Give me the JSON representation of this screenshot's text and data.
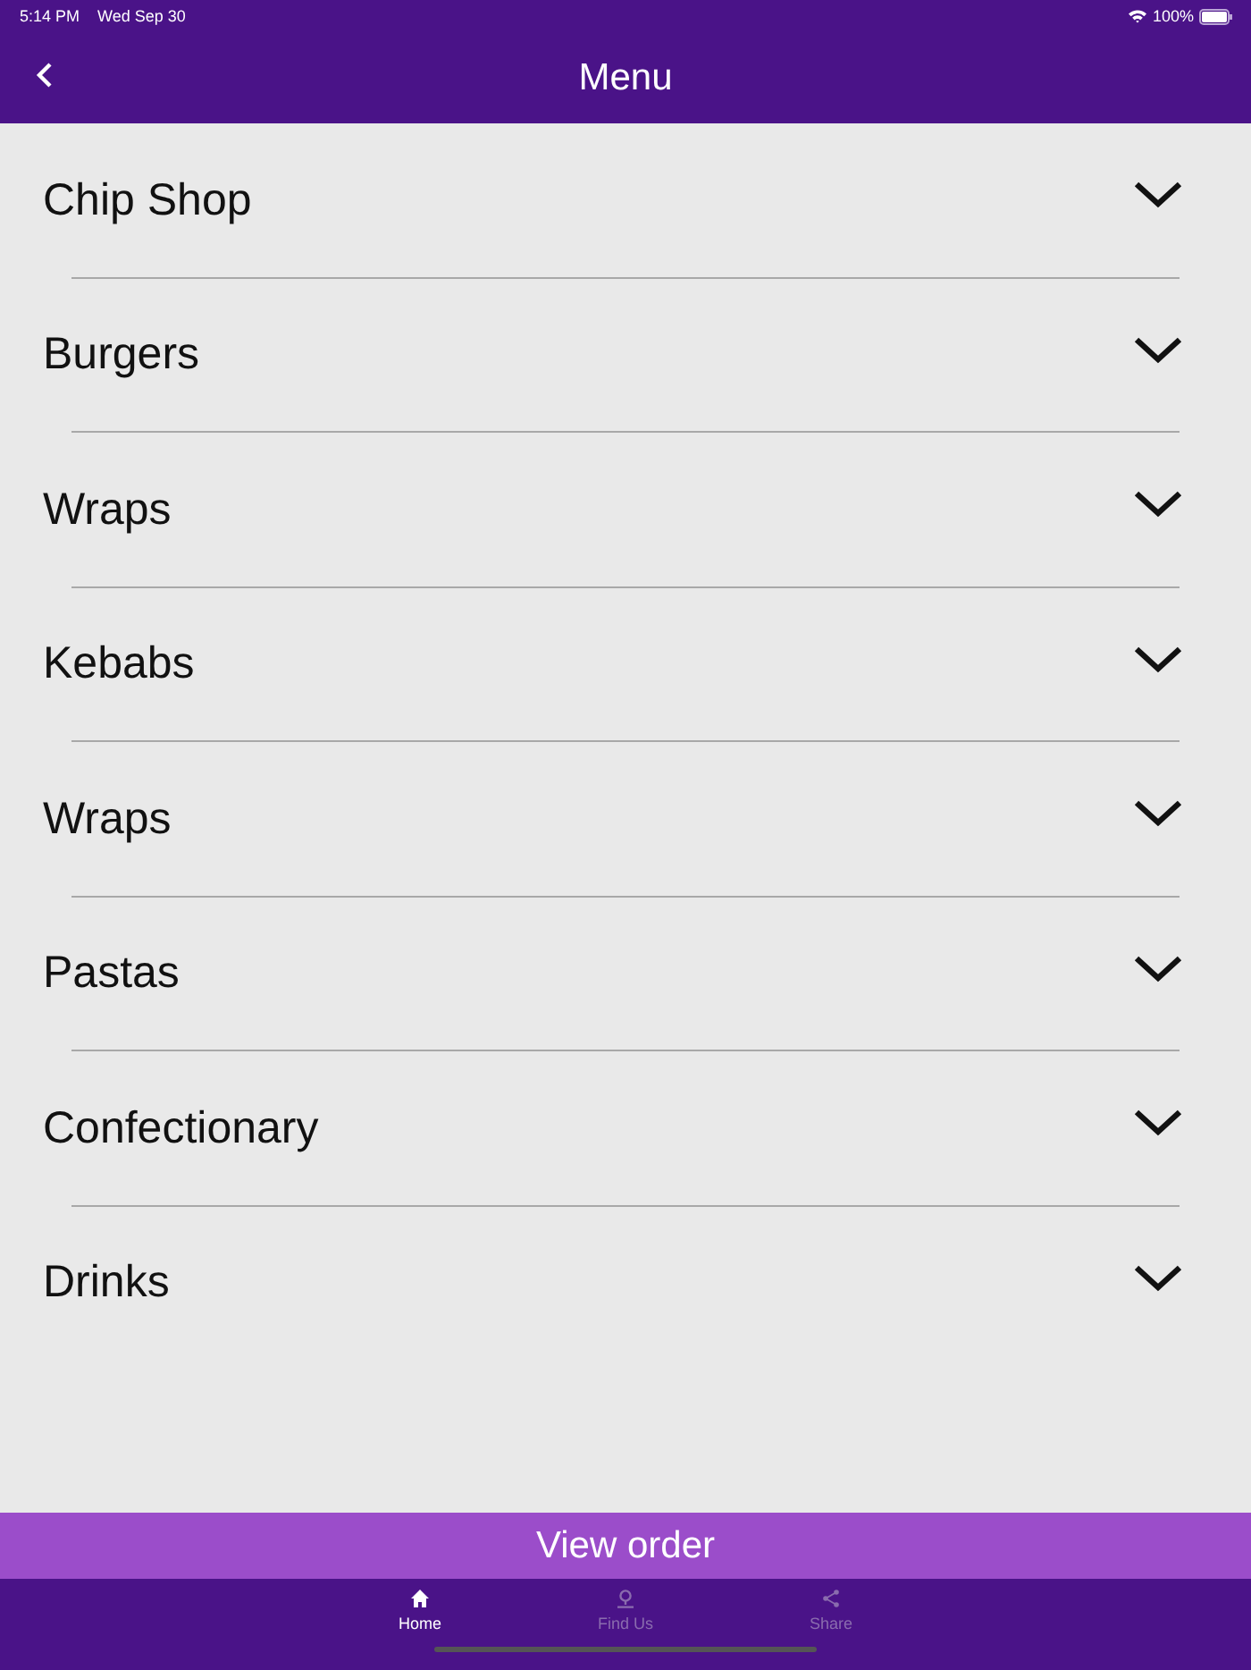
{
  "status_bar": {
    "time": "5:14 PM",
    "date": "Wed Sep 30",
    "battery": "100%"
  },
  "header": {
    "title": "Menu"
  },
  "categories": [
    {
      "label": "Chip Shop",
      "expanded": false
    },
    {
      "label": "Burgers",
      "expanded": false
    },
    {
      "label": "Wraps",
      "expanded": false
    },
    {
      "label": "Kebabs",
      "expanded": false
    },
    {
      "label": "Wraps",
      "expanded": false
    },
    {
      "label": "Pastas",
      "expanded": false
    },
    {
      "label": "Confectionary",
      "expanded": false
    },
    {
      "label": "Drinks",
      "expanded": false
    }
  ],
  "view_order_button": "View order",
  "tabs": [
    {
      "label": "Home",
      "kind": "home",
      "selected": true
    },
    {
      "label": "Find Us",
      "kind": "pin",
      "selected": false
    },
    {
      "label": "Share",
      "kind": "share",
      "selected": false
    }
  ]
}
